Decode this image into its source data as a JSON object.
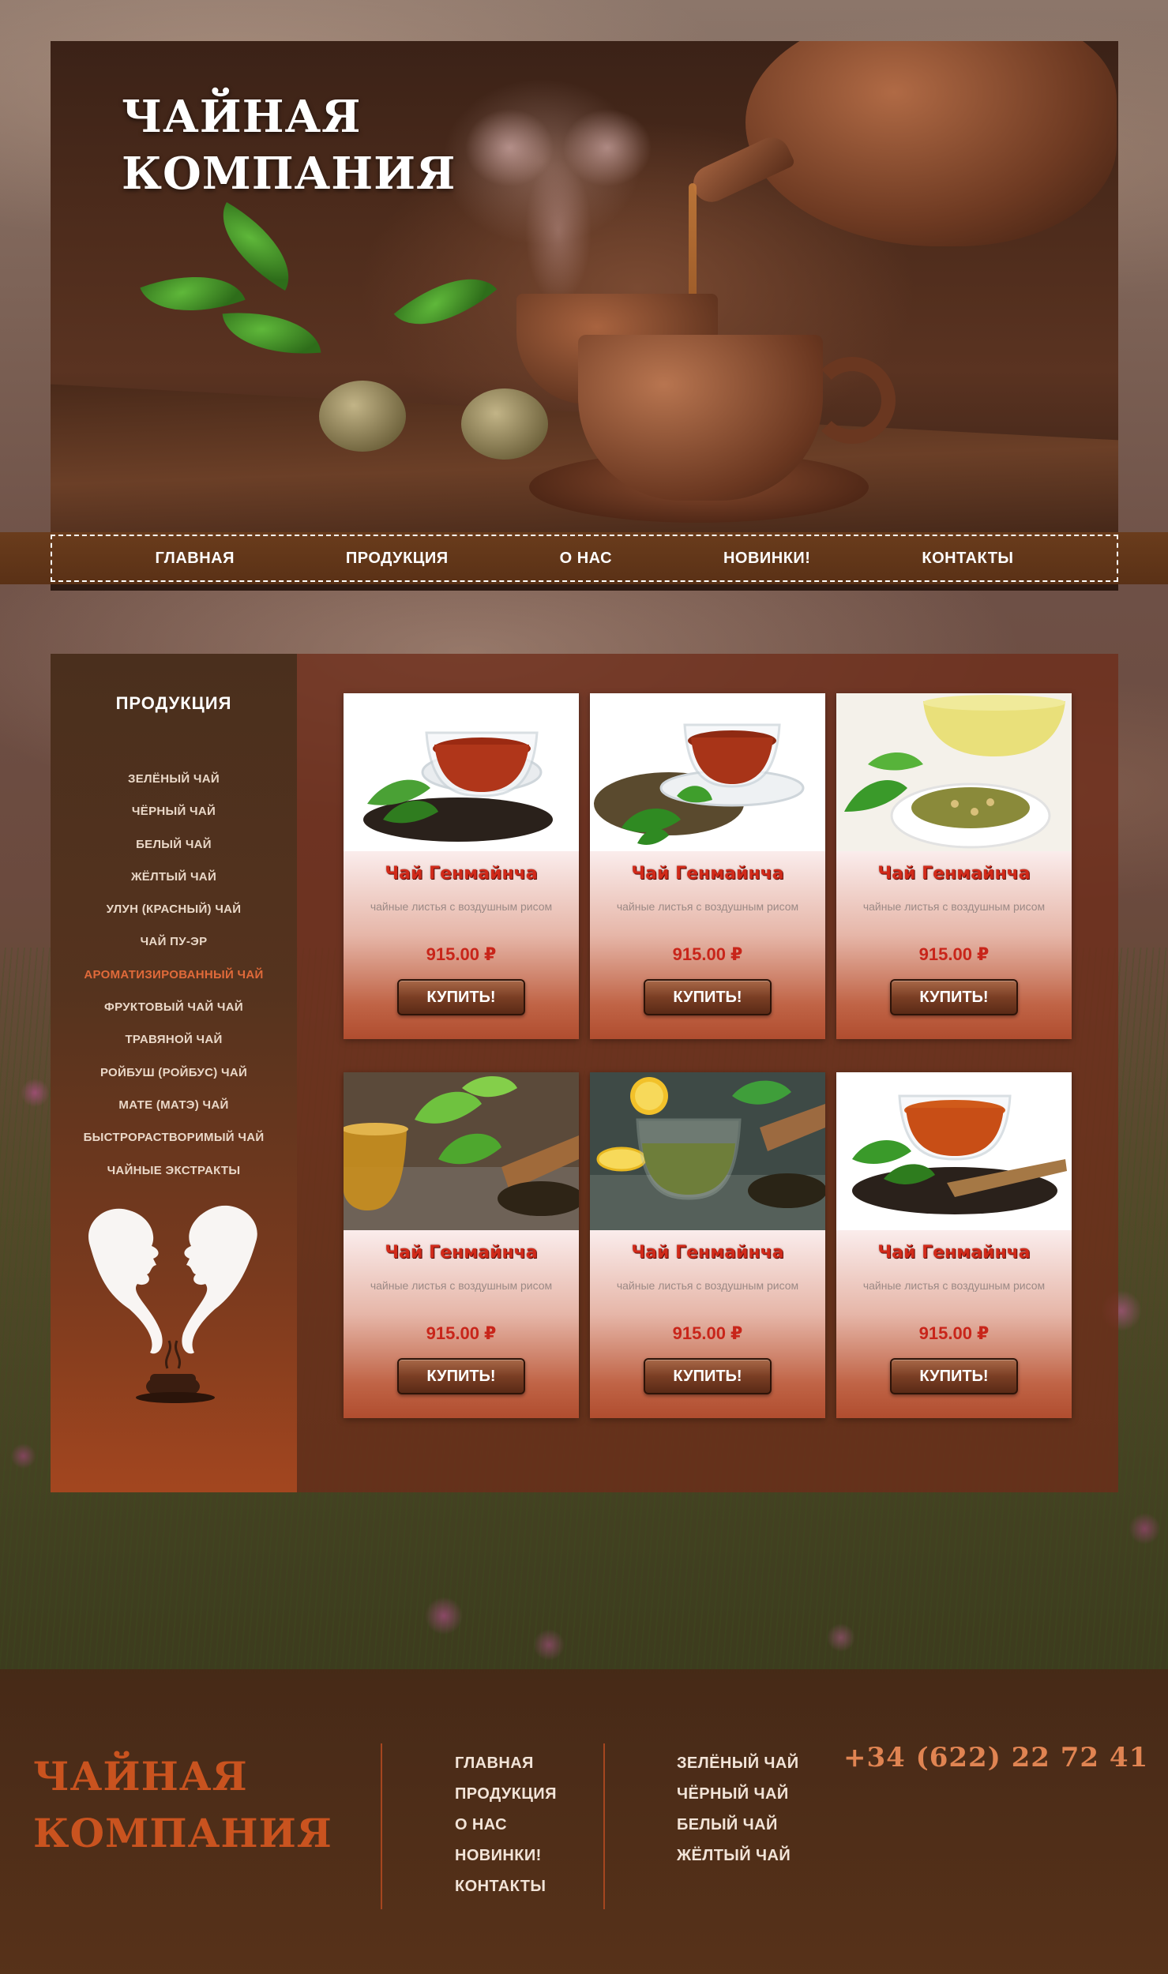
{
  "header": {
    "brand_line1": "ЧАЙНАЯ",
    "brand_line2": "КОМПАНИЯ"
  },
  "nav": {
    "items": [
      {
        "label": "ГЛАВНАЯ"
      },
      {
        "label": "ПРОДУКЦИЯ"
      },
      {
        "label": "О НАС"
      },
      {
        "label": "НОВИНКИ!"
      },
      {
        "label": "КОНТАКТЫ"
      }
    ]
  },
  "sidebar": {
    "title": "ПРОДУКЦИЯ",
    "categories": [
      {
        "label": "ЗЕЛЁНЫЙ ЧАЙ",
        "active": false
      },
      {
        "label": "ЧЁРНЫЙ ЧАЙ",
        "active": false
      },
      {
        "label": "БЕЛЫЙ ЧАЙ",
        "active": false
      },
      {
        "label": "ЖЁЛТЫЙ ЧАЙ",
        "active": false
      },
      {
        "label": "УЛУН (КРАСНЫЙ) ЧАЙ",
        "active": false
      },
      {
        "label": "ЧАЙ ПУ-ЭР",
        "active": false
      },
      {
        "label": "АРОМАТИЗИРОВАННЫЙ ЧАЙ",
        "active": true
      },
      {
        "label": "ФРУКТОВЫЙ ЧАЙ ЧАЙ",
        "active": false
      },
      {
        "label": "ТРАВЯНОЙ ЧАЙ",
        "active": false
      },
      {
        "label": "РОЙБУШ (РОЙБУС) ЧАЙ",
        "active": false
      },
      {
        "label": "МАТЕ (МАТЭ) ЧАЙ",
        "active": false
      },
      {
        "label": "БЫСТРОРАСТВОРИМЫЙ ЧАЙ",
        "active": false
      },
      {
        "label": "ЧАЙНЫЕ ЭКСТРАКТЫ",
        "active": false
      }
    ]
  },
  "products": [
    {
      "name": "Чай Генмайнча",
      "desc": "чайные листья с воздушным рисом",
      "price": "915.00 ₽",
      "buy": "КУПИТЬ!",
      "photo": "black-tea"
    },
    {
      "name": "Чай Генмайнча",
      "desc": "чайные листья с воздушным рисом",
      "price": "915.00 ₽",
      "buy": "КУПИТЬ!",
      "photo": "herbal-tea"
    },
    {
      "name": "Чай Генмайнча",
      "desc": "чайные листья с воздушным рисом",
      "price": "915.00 ₽",
      "buy": "КУПИТЬ!",
      "photo": "yellow-tea"
    },
    {
      "name": "Чай Генмайнча",
      "desc": "чайные листья с воздушным рисом",
      "price": "915.00 ₽",
      "buy": "КУПИТЬ!",
      "photo": "green-leaves-tea"
    },
    {
      "name": "Чай Генмайнча",
      "desc": "чайные листья с воздушным рисом",
      "price": "915.00 ₽",
      "buy": "КУПИТЬ!",
      "photo": "lemon-green-tea"
    },
    {
      "name": "Чай Генмайнча",
      "desc": "чайные листья с воздушным рисом",
      "price": "915.00 ₽",
      "buy": "КУПИТЬ!",
      "photo": "red-tea"
    }
  ],
  "footer": {
    "brand_line1": "ЧАЙНАЯ",
    "brand_line2": "КОМПАНИЯ",
    "nav": [
      "ГЛАВНАЯ",
      "ПРОДУКЦИЯ",
      "О НАС",
      "НОВИНКИ!",
      "КОНТАКТЫ"
    ],
    "categories": [
      "ЗЕЛЁНЫЙ ЧАЙ",
      "ЧЁРНЫЙ ЧАЙ",
      "БЕЛЫЙ ЧАЙ",
      "ЖЁЛТЫЙ ЧАЙ"
    ],
    "phone": "+34 (622) 22 72 41"
  },
  "colors": {
    "accent": "#c9531f",
    "active_category": "#e06a3a",
    "product_name": "#d12a1a",
    "price": "#c8251a"
  }
}
